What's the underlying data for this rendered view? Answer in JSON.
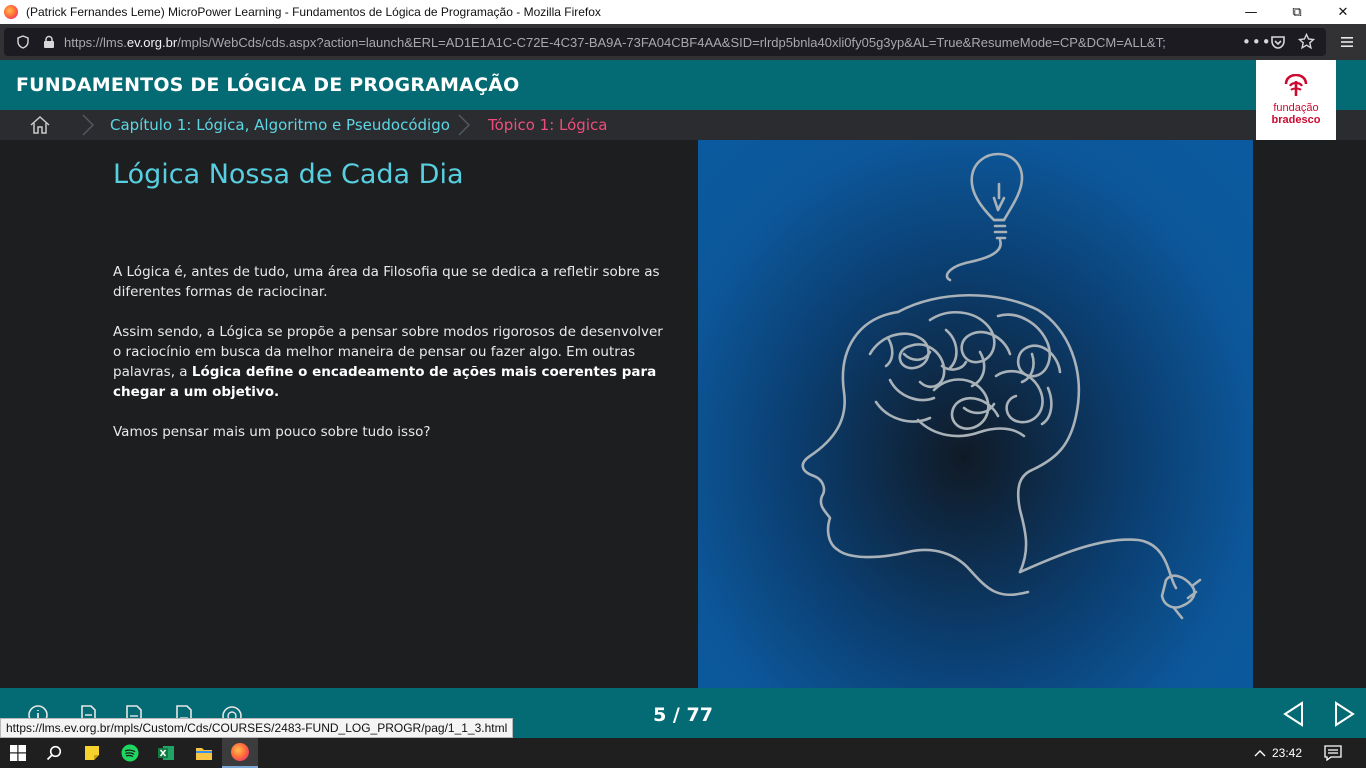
{
  "window": {
    "title": "(Patrick Fernandes Leme) MicroPower Learning - Fundamentos de Lógica de Programação - Mozilla Firefox"
  },
  "browser": {
    "url_prefix": "https://lms.",
    "url_domain": "ev.org.br",
    "url_path": "/mpls/WebCds/cds.aspx?action=launch&ERL=AD1E1A1C-C72E-4C37-BA9A-73FA04CBF4AA&SID=rlrdp5bnla40xli0fy05g3yp&AL=True&ResumeMode=CP&DCM=ALL&T;",
    "status_link": "https://lms.ev.org.br/mpls/Custom/Cds/COURSES/2483-FUND_LOG_PROGR/pag/1_1_3.html"
  },
  "course": {
    "title": "FUNDAMENTOS DE LÓGICA DE PROGRAMAÇÃO",
    "brand_line1": "fundação",
    "brand_line2": "bradesco",
    "accent": "#046b74"
  },
  "breadcrumb": {
    "chapter": "Capítulo 1: Lógica, Algoritmo e Pseudocódigo",
    "topic": "Tópico 1: Lógica"
  },
  "lesson": {
    "heading": "Lógica Nossa de Cada Dia",
    "p1": "A Lógica é, antes de tudo, uma área da Filosofia que se dedica a refletir sobre as diferentes formas de raciocinar.",
    "p2_normal": "Assim sendo, a Lógica se propõe a pensar sobre modos rigorosos de desenvolver o raciocínio em busca da melhor maneira de pensar ou fazer algo. Em outras palavras, a ",
    "p2_bold": "Lógica define o encadeamento de ações mais coerentes para chegar a um objetivo.",
    "p3": "Vamos pensar mais um pouco sobre tudo isso?"
  },
  "pager": {
    "current": "5",
    "total": "77",
    "display": "5 / 77"
  },
  "taskbar": {
    "time": "23:42"
  }
}
